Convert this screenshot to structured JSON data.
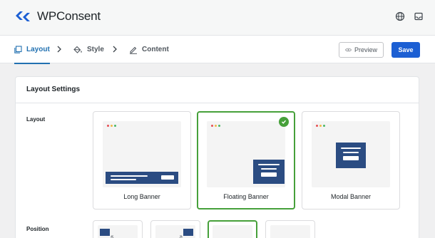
{
  "brand": {
    "name": "WPConsent"
  },
  "header_icons": [
    "globe-icon",
    "inbox-icon"
  ],
  "steps": [
    {
      "label": "Layout",
      "icon": "layout-icon",
      "active": true
    },
    {
      "label": "Style",
      "icon": "paint-bucket-icon",
      "active": false
    },
    {
      "label": "Content",
      "icon": "pencil-icon",
      "active": false
    }
  ],
  "actions": {
    "preview_label": "Preview",
    "save_label": "Save"
  },
  "panel": {
    "title": "Layout Settings",
    "layout_label": "Layout",
    "position_label": "Position",
    "layout_options": [
      {
        "label": "Long Banner",
        "selected": false
      },
      {
        "label": "Floating Banner",
        "selected": true
      },
      {
        "label": "Modal Banner",
        "selected": false
      }
    ]
  },
  "colors": {
    "accent": "#1c5fd3",
    "selected": "#46a03a",
    "banner": "#2b4c82"
  }
}
